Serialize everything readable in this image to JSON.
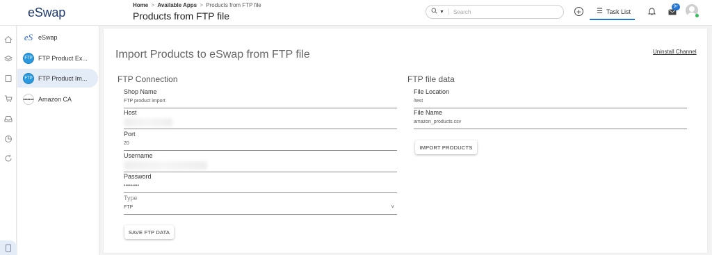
{
  "header": {
    "brand": "eSwap",
    "breadcrumb": {
      "home": "Home",
      "available_apps": "Available Apps",
      "current": "Products from FTP file",
      "sep": ">"
    },
    "page_title": "Products from FTP file",
    "search_placeholder": "Search",
    "task_list_label": "Task List",
    "mail_badge": "9+"
  },
  "rail": {
    "icons": [
      "home-icon",
      "layers-icon",
      "book-icon",
      "cart-icon",
      "inbox-icon",
      "chart-pie-icon",
      "sync-icon",
      "tablet-icon"
    ]
  },
  "apps": {
    "items": [
      {
        "label": "eSwap",
        "logo": "eS"
      },
      {
        "label": "FTP Product Ex...",
        "logo": "FTP"
      },
      {
        "label": "FTP Product Im...",
        "logo": "FTP",
        "active": true
      },
      {
        "label": "Amazon CA",
        "logo": "amazon"
      }
    ]
  },
  "main": {
    "title": "Import Products to eSwap from FTP file",
    "uninstall_link": "Uninstall Channel",
    "ftp_connection": {
      "title": "FTP Connection",
      "shop_name_label": "Shop Name",
      "shop_name_value": "FTP product import",
      "host_label": "Host",
      "port_label": "Port",
      "port_value": "20",
      "username_label": "Username",
      "password_label": "Password",
      "password_value": "•••••••••",
      "type_label": "Type",
      "type_value": "FTP",
      "save_button": "SAVE FTP DATA"
    },
    "ftp_file_data": {
      "title": "FTP file data",
      "file_location_label": "File Location",
      "file_location_value": "/test",
      "file_name_label": "File Name",
      "file_name_value": "amazon_products.csv",
      "import_button": "IMPORT PRODUCTS"
    }
  },
  "colors": {
    "accent": "#1f74d4",
    "brand": "#1e3a6e",
    "active_bg": "#e4ecf7"
  }
}
